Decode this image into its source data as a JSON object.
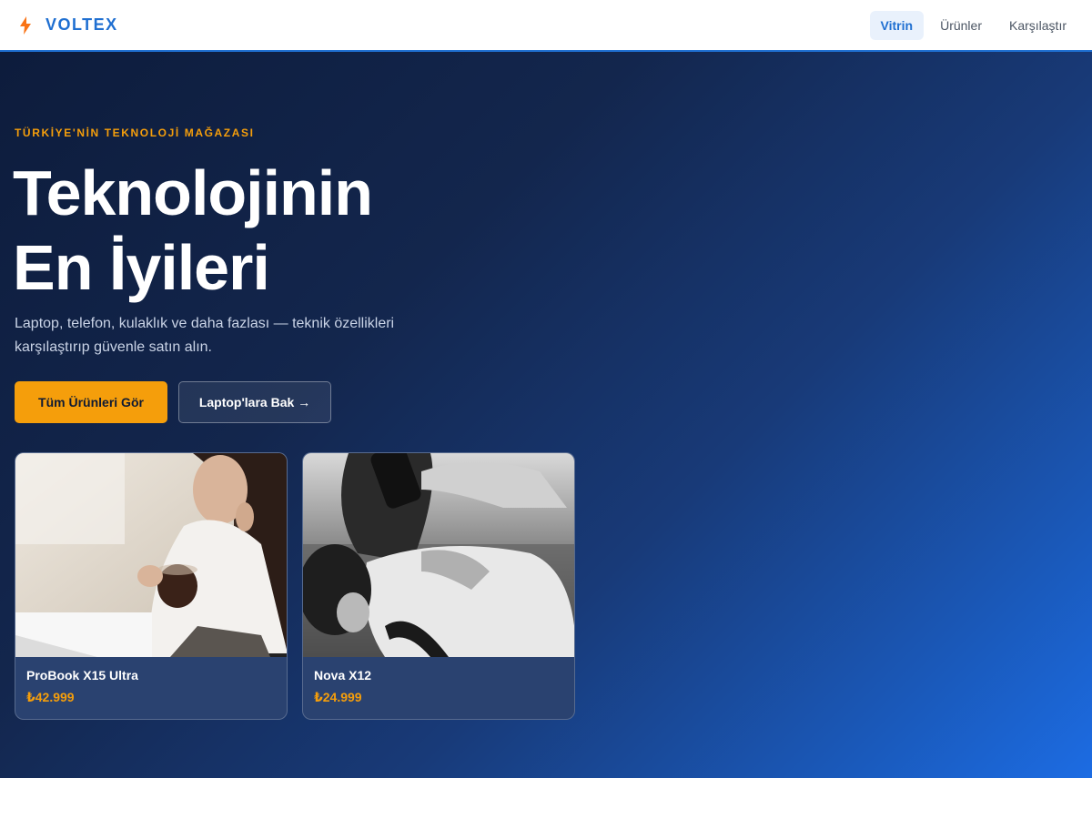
{
  "header": {
    "brand": "VOLTEX",
    "brand_icon": "lightning-bolt-icon",
    "nav": [
      {
        "label": "Vitrin",
        "active": true
      },
      {
        "label": "Ürünler",
        "active": false
      },
      {
        "label": "Karşılaştır",
        "active": false
      }
    ]
  },
  "hero": {
    "eyebrow": "TÜRKİYE'NİN TEKNOLOJİ MAĞAZASI",
    "title_line1": "Teknolojinin",
    "title_line2": "En İyileri",
    "subtitle": "Laptop, telefon, kulaklık ve daha fazlası — teknik özellikleri karşılaştırıp güvenle satın alın.",
    "primary_cta": "Tüm Ürünleri Gör",
    "secondary_cta": "Laptop'lara Bak →"
  },
  "products": [
    {
      "name": "ProBook X15 Ultra",
      "price": "₺42.999"
    },
    {
      "name": "Nova X12",
      "price": "₺24.999"
    }
  ],
  "colors": {
    "accent": "#1f6fd1",
    "highlight": "#f59e0b",
    "hero_dark": "#0d1c3c",
    "hero_light": "#1c6ce3"
  }
}
